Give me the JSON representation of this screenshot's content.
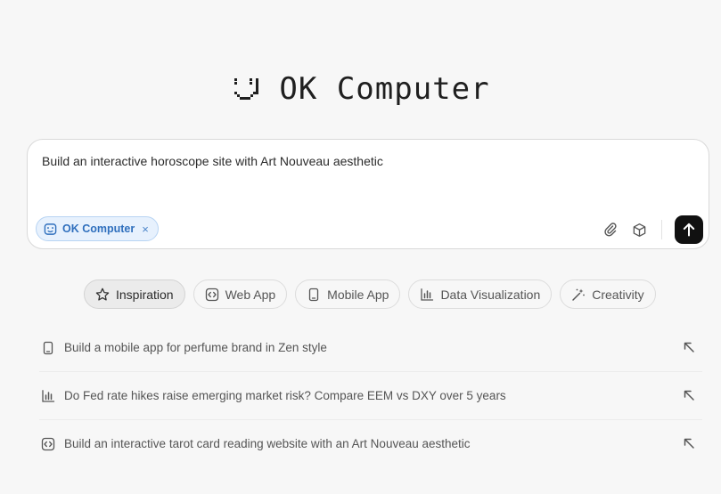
{
  "app": {
    "title": "OK Computer"
  },
  "composer": {
    "prompt": "Build an interactive horoscope site with Art Nouveau aesthetic",
    "mode_chip": {
      "label": "OK Computer",
      "close": "×",
      "icon": "robot-face-icon"
    },
    "tools": [
      {
        "name": "attach",
        "icon": "paperclip-icon"
      },
      {
        "name": "components",
        "icon": "cube-icon"
      }
    ],
    "send_icon": "arrow-up-icon"
  },
  "tabs": [
    {
      "label": "Inspiration",
      "icon": "star-icon",
      "active": true
    },
    {
      "label": "Web App",
      "icon": "code-icon",
      "active": false
    },
    {
      "label": "Mobile App",
      "icon": "mobile-icon",
      "active": false
    },
    {
      "label": "Data Visualization",
      "icon": "bar-chart-icon",
      "active": false
    },
    {
      "label": "Creativity",
      "icon": "magic-wand-icon",
      "active": false
    }
  ],
  "suggestions": [
    {
      "text": "Build a mobile app for perfume brand in Zen style",
      "icon": "mobile-icon"
    },
    {
      "text": "Do Fed rate hikes raise emerging market risk? Compare EEM vs DXY over 5 years",
      "icon": "bar-chart-icon"
    },
    {
      "text": "Build an interactive tarot card reading website with an Art Nouveau aesthetic",
      "icon": "code-icon"
    }
  ],
  "colors": {
    "background": "#f7f7f7",
    "accent_blue": "#2f6fbd",
    "send_button": "#111111"
  }
}
